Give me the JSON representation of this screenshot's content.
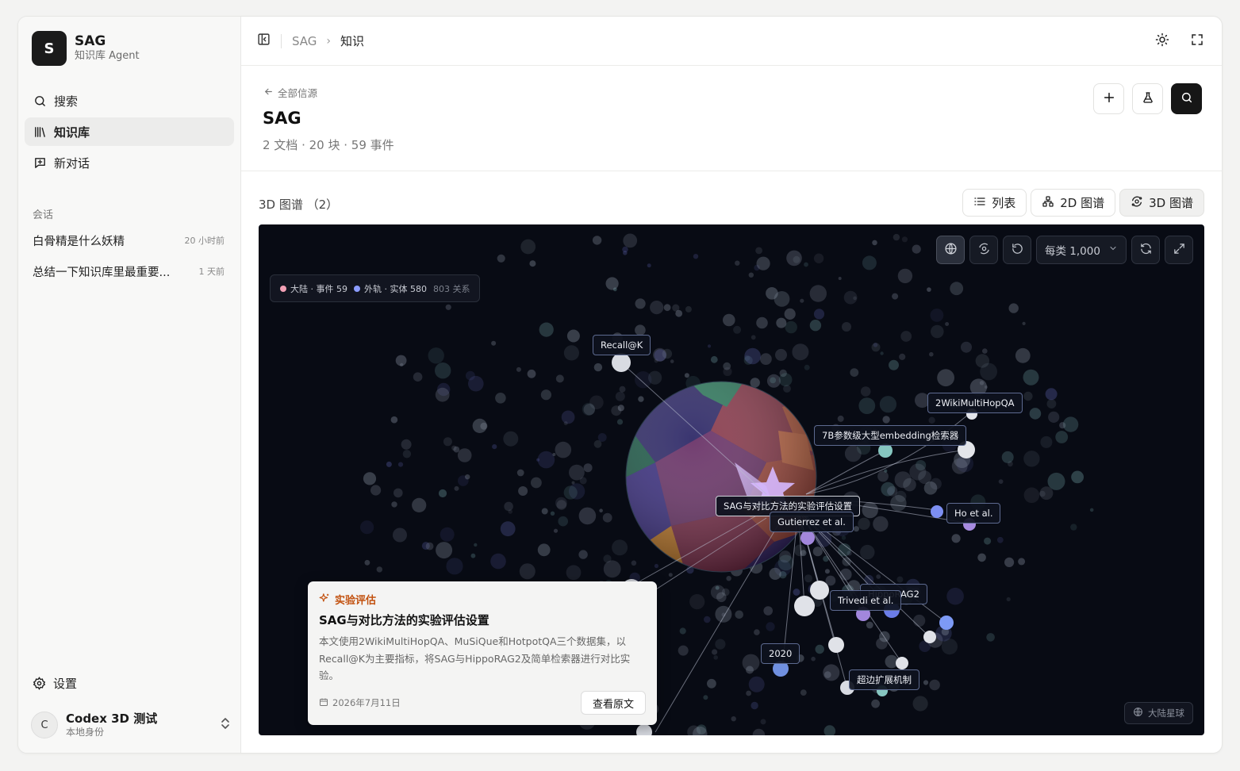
{
  "brand": {
    "initial": "S",
    "name": "SAG",
    "subtitle": "知识库 Agent"
  },
  "nav": [
    {
      "label": "搜索",
      "icon": "search-icon"
    },
    {
      "label": "知识库",
      "icon": "library-icon",
      "active": true
    },
    {
      "label": "新对话",
      "icon": "new-chat-icon"
    }
  ],
  "conversations": {
    "label": "会话",
    "items": [
      {
        "title": "白骨精是什么妖精",
        "time": "20 小时前"
      },
      {
        "title": "总结一下知识库里最重要...",
        "time": "1 天前"
      }
    ]
  },
  "settings": {
    "label": "设置"
  },
  "user": {
    "initial": "C",
    "name": "Codex 3D 测试",
    "subtitle": "本地身份"
  },
  "breadcrumb": {
    "root": "SAG",
    "current": "知识"
  },
  "header": {
    "back_label": "全部信源",
    "title": "SAG",
    "stats": "2 文档 · 20 块 · 59 事件"
  },
  "view": {
    "title": "3D 图谱 （2）",
    "tabs": [
      {
        "label": "列表",
        "icon": "list-icon"
      },
      {
        "label": "2D 图谱",
        "icon": "graph-2d-icon"
      },
      {
        "label": "3D 图谱",
        "icon": "graph-3d-icon",
        "active": true
      }
    ]
  },
  "graph": {
    "legend": {
      "continent": "大陆 · 事件 59",
      "orbit": "外轨 · 实体 580",
      "relations": "803 关系",
      "continent_color": "#f2a0b5",
      "orbit_color": "#8b9cff"
    },
    "per_type_select": "每类 1,000",
    "planet_badge": "大陆星球",
    "labels": {
      "recall": "Recall@K",
      "wiki": "2WikiMultiHopQA",
      "embed": "7B参数级大型embedding检索器",
      "main": "SAG与对比方法的实验评估设置",
      "gutierrez": "Gutierrez et al.",
      "ho": "Ho et al.",
      "hippo": "HippoRAG2",
      "trivedi": "Trivedi et al.",
      "year": "2020",
      "edge": "超边扩展机制"
    }
  },
  "card": {
    "tag": "实验评估",
    "title": "SAG与对比方法的实验评估设置",
    "body": "本文使用2WikiMultiHopQA、MuSiQue和HotpotQA三个数据集，以Recall@K为主要指标，将SAG与HippoRAG2及简单检索器进行对比实验。",
    "date": "2026年7月11日",
    "button": "查看原文"
  }
}
